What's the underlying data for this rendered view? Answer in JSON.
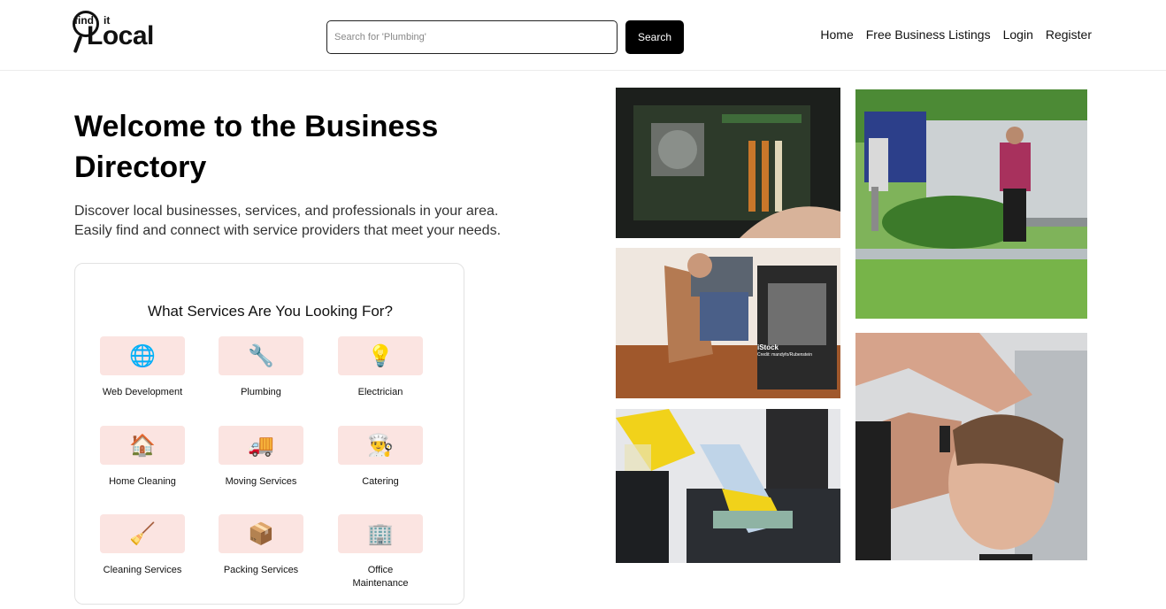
{
  "header": {
    "logo": {
      "find": "find",
      "it": "it",
      "local": "Local"
    },
    "search": {
      "placeholder": "Search for 'Plumbing'",
      "button_label": "Search"
    },
    "nav": [
      "Home",
      "Free Business Listings",
      "Login",
      "Register"
    ]
  },
  "hero": {
    "title": "Welcome to the Business Directory",
    "subtitle_line1": "Discover local businesses, services, and professionals in your area.",
    "subtitle_line2": "Easily find and connect with service providers that meet your needs."
  },
  "services": {
    "title": "What Services Are You Looking For?",
    "items": [
      {
        "label": "Web Development",
        "icon": "globe-icon",
        "glyph": "🌐"
      },
      {
        "label": "Plumbing",
        "icon": "wrench-icon",
        "glyph": "🔧"
      },
      {
        "label": "Electrician",
        "icon": "lightbulb-icon",
        "glyph": "💡"
      },
      {
        "label": "Home Cleaning",
        "icon": "house-icon",
        "glyph": "🏠"
      },
      {
        "label": "Moving Services",
        "icon": "truck-icon",
        "glyph": "🚚"
      },
      {
        "label": "Catering",
        "icon": "cook-icon",
        "glyph": "👨‍🍳"
      },
      {
        "label": "Cleaning Services",
        "icon": "broom-icon",
        "glyph": "🧹"
      },
      {
        "label": "Packing Services",
        "icon": "package-icon",
        "glyph": "📦"
      },
      {
        "label": "Office Maintenance",
        "icon": "office-building-icon",
        "glyph": "🏢"
      }
    ]
  },
  "photos": {
    "watermark_brand": "iStock",
    "watermark_credit": "Credit: mandyfo/Rubenstein",
    "alts": [
      "Computer repair",
      "Plumber fixing wall",
      "Office cleaning",
      "Lawn mowing service",
      "Barber haircut"
    ]
  },
  "colors": {
    "tile_bg": "#fbe4e1",
    "button_bg": "#000000"
  }
}
